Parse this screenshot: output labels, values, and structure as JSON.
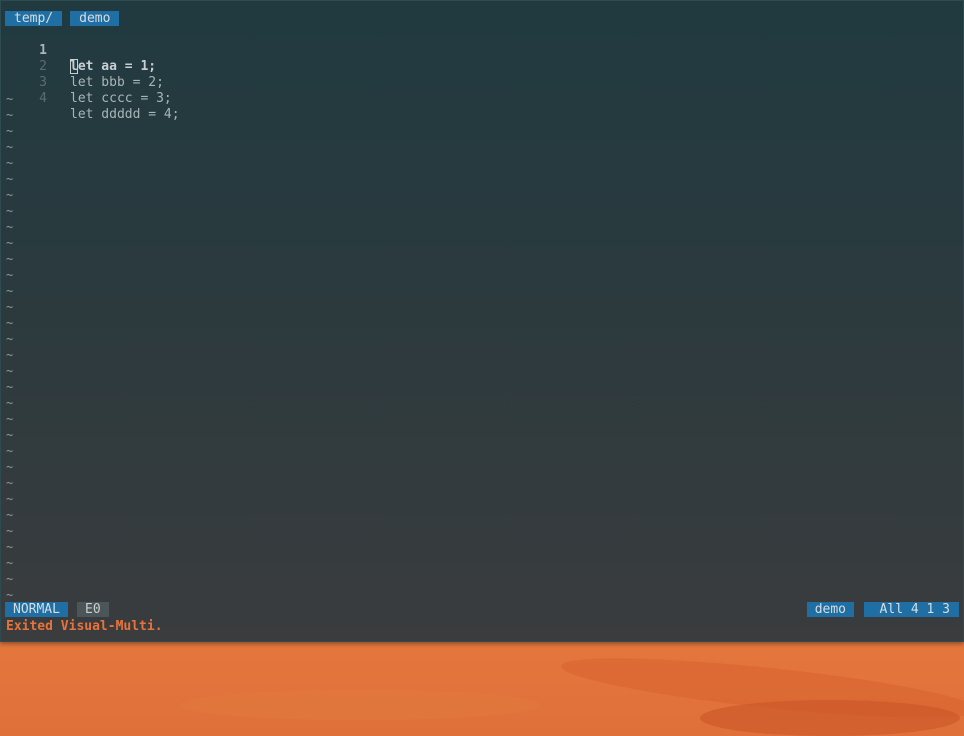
{
  "tabline": {
    "directory_tab": "temp/",
    "file_tab": "demo"
  },
  "buffer": {
    "lines": [
      {
        "number": "1",
        "prefix": "",
        "cursor_char": "l",
        "rest": "et aa = 1;"
      },
      {
        "number": "2",
        "text": "let bbb = 2;"
      },
      {
        "number": "3",
        "text": "let cccc = 3;"
      },
      {
        "number": "4",
        "text": "let ddddd = 4;"
      }
    ],
    "empty_marker": "~"
  },
  "statusline": {
    "mode": "NORMAL",
    "errors": "E0",
    "filename": "demo",
    "position": "All 4 1 3"
  },
  "message": "Exited Visual-Multi.",
  "colors": {
    "accent": "#1f6fa4",
    "message": "#e8733a",
    "background": "#2b3a3e"
  }
}
